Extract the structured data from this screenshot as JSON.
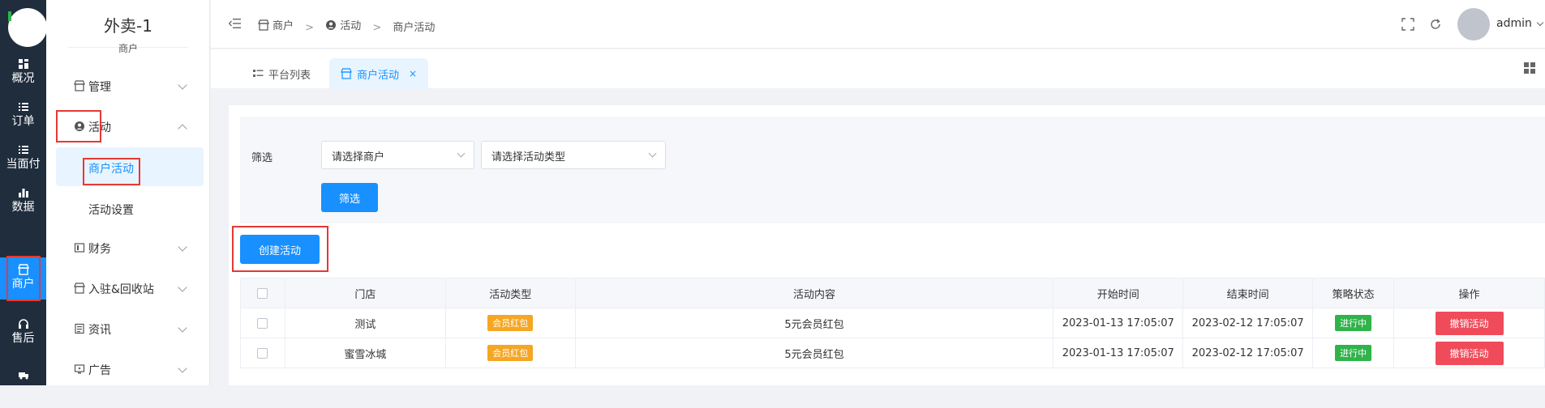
{
  "rail": {
    "items": [
      {
        "label": "概况",
        "icon": "dashboard-icon"
      },
      {
        "label": "订单",
        "icon": "list-icon"
      },
      {
        "label": "当面付",
        "icon": "list-icon"
      },
      {
        "label": "数据",
        "icon": "bar-chart-icon"
      },
      {
        "label": "商户",
        "icon": "store-icon"
      },
      {
        "label": "售后",
        "icon": "headset-icon"
      }
    ]
  },
  "sidebar": {
    "title": "外卖-1",
    "subtitle": "商户",
    "menu": [
      {
        "label": "管理",
        "icon": "store-icon"
      },
      {
        "label": "活动",
        "icon": "user-circle-icon"
      },
      {
        "label": "财务",
        "icon": "wallet-icon"
      },
      {
        "label": "入驻&回收站",
        "icon": "store-icon"
      },
      {
        "label": "资讯",
        "icon": "document-icon"
      },
      {
        "label": "广告",
        "icon": "monitor-icon"
      }
    ],
    "sub": [
      {
        "label": "商户活动"
      },
      {
        "label": "活动设置"
      }
    ]
  },
  "header": {
    "breadcrumb": [
      "商户",
      "活动",
      "商户活动"
    ],
    "breadcrumb_sep": ">",
    "user": "admin"
  },
  "tabs": [
    {
      "label": "平台列表"
    },
    {
      "label": "商户活动",
      "close": "×"
    }
  ],
  "filter": {
    "label": "筛选",
    "merchant_placeholder": "请选择商户",
    "type_placeholder": "请选择活动类型",
    "button": "筛选"
  },
  "create_button": "创建活动",
  "table": {
    "headers": [
      "门店",
      "活动类型",
      "活动内容",
      "开始时间",
      "结束时间",
      "策略状态",
      "操作"
    ],
    "rows": [
      {
        "store": "测试",
        "type": "会员红包",
        "content": "5元会员红包",
        "start": "2023-01-13 17:05:07",
        "end": "2023-02-12 17:05:07",
        "status": "进行中",
        "action": "撤销活动"
      },
      {
        "store": "蜜雪冰城",
        "type": "会员红包",
        "content": "5元会员红包",
        "start": "2023-01-13 17:05:07",
        "end": "2023-02-12 17:05:07",
        "status": "进行中",
        "action": "撤销活动"
      }
    ]
  },
  "colors": {
    "primary": "#1890ff",
    "rail_bg": "#1f2d3d",
    "danger": "#f04b5a",
    "tag_orange": "#f5a623",
    "tag_green": "#2fb34a",
    "highlight_box": "#e53935"
  }
}
